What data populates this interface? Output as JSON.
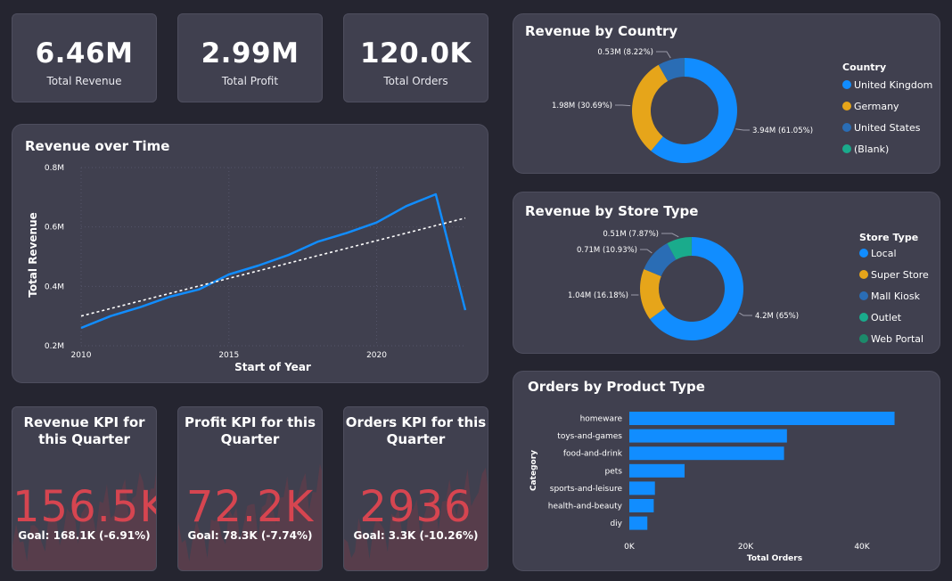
{
  "kpis": [
    {
      "value": "6.46M",
      "label": "Total Revenue"
    },
    {
      "value": "2.99M",
      "label": "Total Profit"
    },
    {
      "value": "120.0K",
      "label": "Total Orders"
    }
  ],
  "revenue_over_time": {
    "title": "Revenue over Time",
    "xlabel": "Start of Year",
    "ylabel": "Total Revenue",
    "x_ticks": [
      "2010",
      "2015",
      "2020"
    ],
    "y_ticks": [
      "0.2M",
      "0.4M",
      "0.6M",
      "0.8M"
    ]
  },
  "revenue_by_country": {
    "title": "Revenue by Country",
    "legend_title": "Country",
    "legend": [
      "United Kingdom",
      "Germany",
      "United States",
      "(Blank)"
    ],
    "labels": [
      "3.94M (61.05%)",
      "1.98M (30.69%)",
      "0.53M (8.22%)"
    ]
  },
  "revenue_by_store_type": {
    "title": "Revenue by Store Type",
    "legend_title": "Store Type",
    "legend": [
      "Local",
      "Super Store",
      "Mall Kiosk",
      "Outlet",
      "Web Portal"
    ],
    "labels": [
      "4.2M (65%)",
      "1.04M (16.18%)",
      "0.71M (10.93%)",
      "0.51M (7.87%)"
    ]
  },
  "orders_by_product_type": {
    "title": "Orders by Product Type",
    "ylabel": "Category",
    "xlabel": "Total Orders",
    "x_ticks": [
      "0K",
      "20K",
      "40K"
    ]
  },
  "quarter_kpis": [
    {
      "title": "Revenue KPI for this Quarter",
      "value": "156.5K",
      "goal": "Goal: 168.1K (-6.91%)"
    },
    {
      "title": "Profit KPI for this Quarter",
      "value": "72.2K",
      "goal": "Goal: 78.3K (-7.74%)"
    },
    {
      "title": "Orders KPI for this Quarter",
      "value": "2936",
      "goal": "Goal: 3.3K (-10.26%)"
    }
  ],
  "colors": {
    "blue": "#118dff",
    "yellow": "#e6a51a",
    "steel": "#2a6db5",
    "teal": "#1aab8c",
    "green": "#1c8a6a",
    "red": "#d64550"
  },
  "chart_data": [
    {
      "type": "line",
      "title": "Revenue over Time",
      "xlabel": "Start of Year",
      "ylabel": "Total Revenue",
      "x": [
        2010,
        2011,
        2012,
        2013,
        2014,
        2015,
        2016,
        2017,
        2018,
        2019,
        2020,
        2021,
        2022,
        2023
      ],
      "series": [
        {
          "values": [
            0.26,
            0.3,
            0.33,
            0.365,
            0.39,
            0.44,
            0.47,
            0.505,
            0.55,
            0.58,
            0.615,
            0.67,
            0.71,
            0.32
          ]
        }
      ],
      "trend": [
        0.3,
        0.63
      ],
      "ylim": [
        0.2,
        0.8
      ],
      "xlim": [
        2010,
        2023
      ]
    },
    {
      "type": "pie",
      "title": "Revenue by Country",
      "categories": [
        "United Kingdom",
        "Germany",
        "United States",
        "(Blank)"
      ],
      "values": [
        3.94,
        1.98,
        0.53,
        0.0
      ],
      "percentages": [
        61.05,
        30.69,
        8.22,
        0.04
      ]
    },
    {
      "type": "pie",
      "title": "Revenue by Store Type",
      "categories": [
        "Local",
        "Super Store",
        "Mall Kiosk",
        "Outlet",
        "Web Portal"
      ],
      "values": [
        4.2,
        1.04,
        0.71,
        0.51,
        0.0
      ],
      "percentages": [
        65.0,
        16.18,
        10.93,
        7.87,
        0.02
      ]
    },
    {
      "type": "bar",
      "title": "Orders by Product Type",
      "categories": [
        "homeware",
        "toys-and-games",
        "food-and-drink",
        "pets",
        "sports-and-leisure",
        "health-and-beauty",
        "diy"
      ],
      "values": [
        45600,
        27100,
        26600,
        9500,
        4400,
        4200,
        3100
      ],
      "xlabel": "Total Orders",
      "ylabel": "Category",
      "xlim": [
        0,
        50000
      ]
    }
  ]
}
